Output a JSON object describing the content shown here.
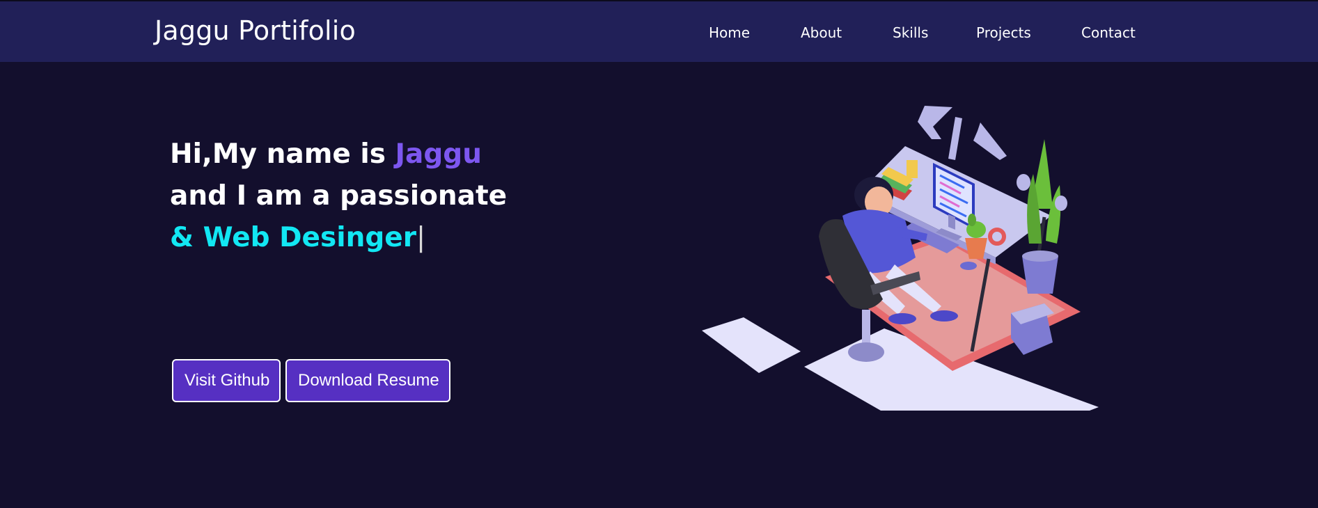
{
  "nav": {
    "brand": "Jaggu Portifolio",
    "links": [
      {
        "label": "Home"
      },
      {
        "label": "About"
      },
      {
        "label": "Skills"
      },
      {
        "label": "Projects"
      },
      {
        "label": "Contact"
      }
    ]
  },
  "hero": {
    "greeting": "Hi,My name is ",
    "name": "Jaggu",
    "line2": "and I am a passionate",
    "role": "& Web Desinger",
    "cursor": "|",
    "buttons": {
      "github": "Visit Github",
      "resume": "Download Resume"
    },
    "illustration_alt": "developer-at-desk-illustration"
  },
  "colors": {
    "page_bg": "#130f2d",
    "navbar_bg": "#212058",
    "accent_purple": "#7d57f0",
    "accent_cyan": "#12e7f3",
    "button_bg": "#5630c2"
  }
}
